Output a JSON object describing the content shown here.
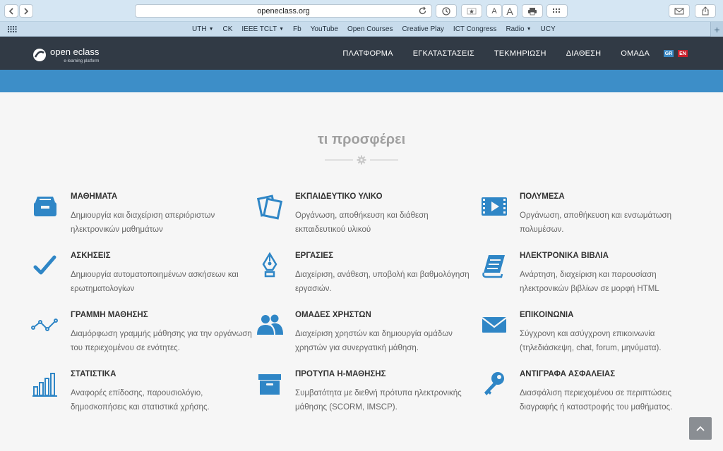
{
  "browser": {
    "url": "openeclass.org",
    "font_small": "A",
    "font_large": "A"
  },
  "bookmarks": [
    {
      "label": "UTH",
      "menu": true
    },
    {
      "label": "CK",
      "menu": false
    },
    {
      "label": "IEEE TCLT",
      "menu": true
    },
    {
      "label": "Fb",
      "menu": false
    },
    {
      "label": "YouTube",
      "menu": false
    },
    {
      "label": "Open Courses",
      "menu": false
    },
    {
      "label": "Creative Play",
      "menu": false
    },
    {
      "label": "ICT Congress",
      "menu": false
    },
    {
      "label": "Radio",
      "menu": true
    },
    {
      "label": "UCY",
      "menu": false
    }
  ],
  "site": {
    "logo_main": "open eclass",
    "logo_sub": "e-learning platform",
    "nav": [
      "ΠΛΑΤΦΟΡΜΑ",
      "ΕΓΚΑΤΑΣΤΑΣΕΙΣ",
      "ΤΕΚΜΗΡΙΩΣΗ",
      "ΔΙΑΘΕΣΗ",
      "ΟΜΑΔΑ"
    ],
    "lang_gr": "GR",
    "lang_en": "EN"
  },
  "section_title": "τι προσφέρει",
  "features": [
    {
      "title": "ΜΑΘΗΜΑΤΑ",
      "desc": "Δημιουργία και διαχείριση απεριόριστων ηλεκτρονικών μαθημάτων",
      "icon": "inbox-icon"
    },
    {
      "title": "ΕΚΠΑΙΔΕΥΤΙΚΟ ΥΛΙΚΟ",
      "desc": "Οργάνωση, αποθήκευση και διάθεση εκπαιδευτικού υλικού",
      "icon": "documents-icon"
    },
    {
      "title": "ΠΟΛΥΜΕΣΑ",
      "desc": "Οργάνωση, αποθήκευση και ενσωμάτωση πολυμέσων.",
      "icon": "film-icon"
    },
    {
      "title": "ΑΣΚΗΣΕΙΣ",
      "desc": "Δημιουργία αυτοματοποιημένων ασκήσεων και ερωτηματολογίων",
      "icon": "checkmark-icon"
    },
    {
      "title": "ΕΡΓΑΣΙΕΣ",
      "desc": "Διαχείριση, ανάθεση, υποβολή και βαθμολόγηση εργασιών.",
      "icon": "pen-nib-icon"
    },
    {
      "title": "ΗΛΕΚΤΡΟΝΙΚΑ ΒΙΒΛΙΑ",
      "desc": "Ανάρτηση, διαχείριση και παρουσίαση ηλεκτρονικών βιβλίων σε μορφή HTML",
      "icon": "book-icon"
    },
    {
      "title": "ΓΡΑΜΜΗ ΜΑΘΗΣΗΣ",
      "desc": "Διαμόρφωση γραμμής μάθησης για την οργάνωση του περιεχομένου σε ενότητες.",
      "icon": "line-path-icon"
    },
    {
      "title": "ΟΜΑΔΕΣ ΧΡΗΣΤΩΝ",
      "desc": "Διαχείριση χρηστών και δημιουργία ομάδων χρηστών για συνεργατική μάθηση.",
      "icon": "users-icon"
    },
    {
      "title": "ΕΠΙΚΟΙΝΩΝΙΑ",
      "desc": "Σύγχρονη και ασύγχρονη επικοινωνία (τηλεδιάσκεψη, chat, forum, μηνύματα).",
      "icon": "envelope-icon"
    },
    {
      "title": "ΣΤΑΤΙΣΤΙΚΑ",
      "desc": "Αναφορές επίδοσης, παρουσιολόγιο, δημοσκοπήσεις και στατιστικά χρήσης.",
      "icon": "bar-chart-icon"
    },
    {
      "title": "ΠΡΟΤΥΠΑ Η-ΜΑΘΗΣΗΣ",
      "desc": "Συμβατότητα με διεθνή πρότυπα ηλεκτρονικής μάθησης (SCORM, IMSCP).",
      "icon": "archive-icon"
    },
    {
      "title": "ΑΝΤΙΓΡΑΦΑ ΑΣΦΑΛΕΙΑΣ",
      "desc": "Διασφάλιση περιεχομένου σε περιπτώσεις διαγραφής ή καταστροφής του μαθήματος.",
      "icon": "key-icon"
    }
  ],
  "colors": {
    "accent": "#2f86c6",
    "nav_bg": "#313a45",
    "band": "#3d8ec8"
  }
}
